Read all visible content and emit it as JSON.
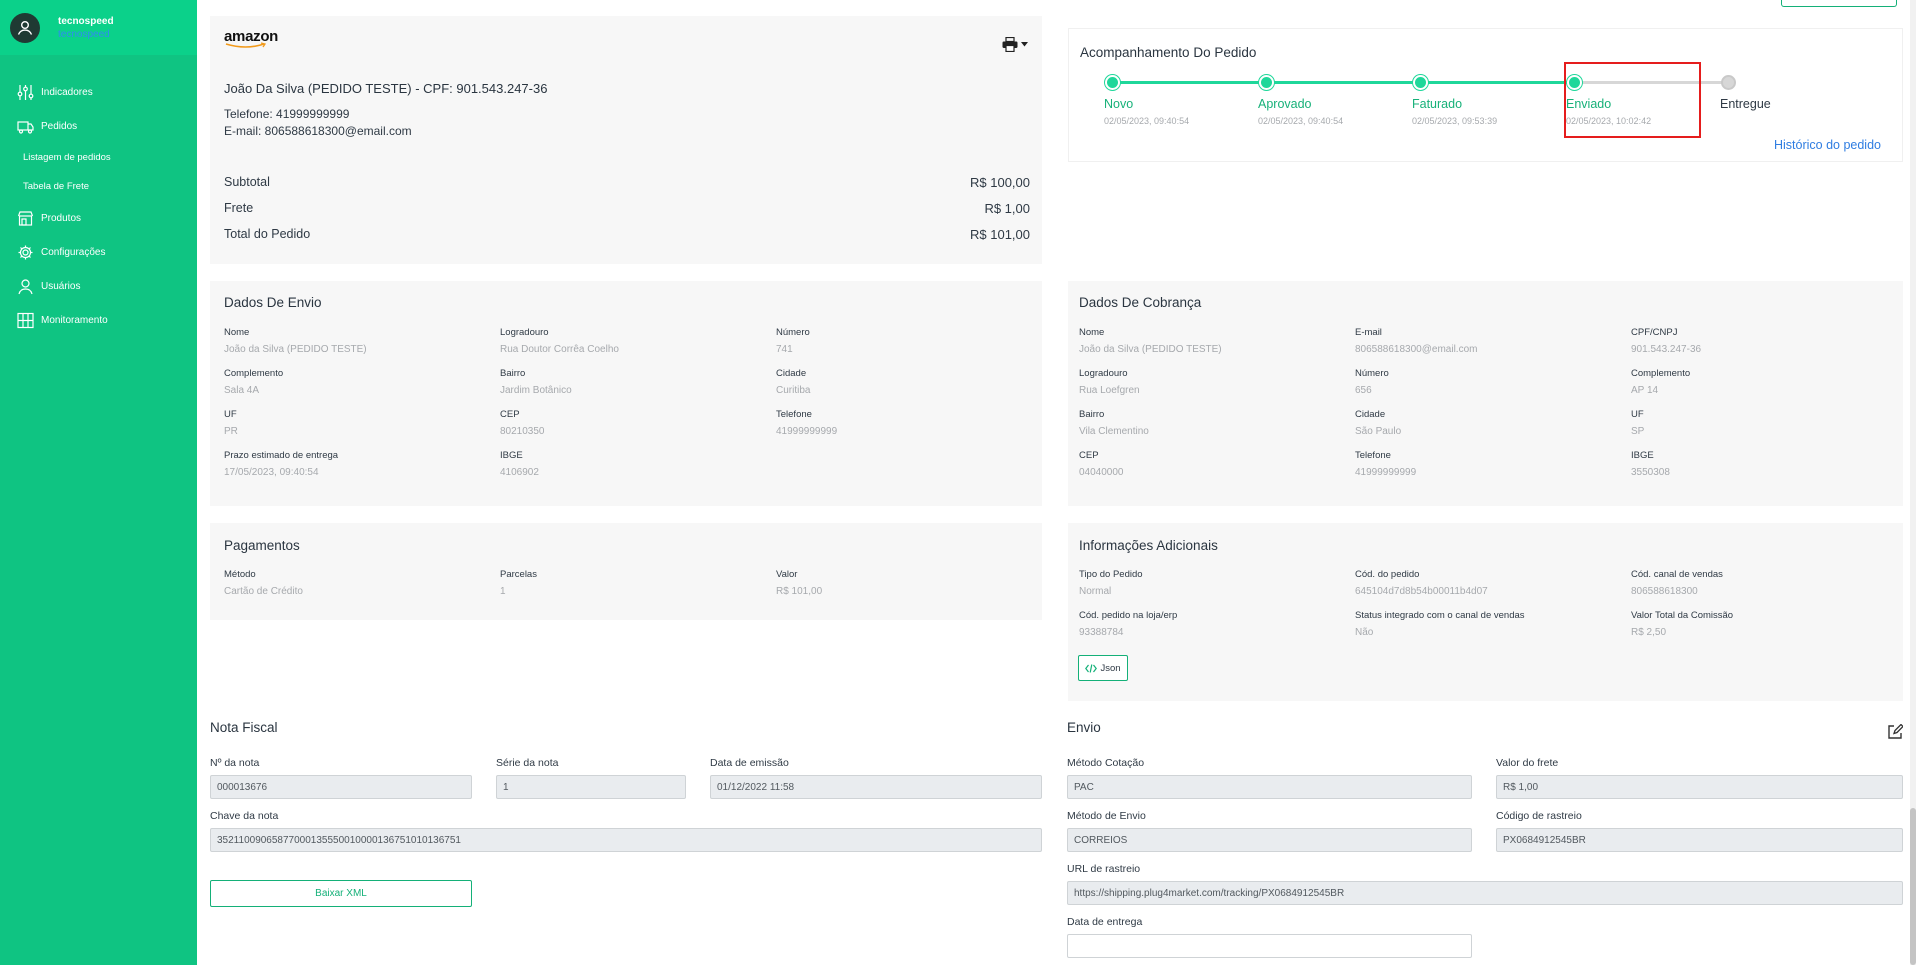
{
  "sidebar": {
    "user": {
      "name": "tecnospeed",
      "subname": "tecnospeed"
    },
    "items": [
      {
        "label": "Indicadores",
        "icon": "sliders-icon"
      },
      {
        "label": "Pedidos",
        "icon": "truck-icon"
      },
      {
        "label": "Listagem de pedidos"
      },
      {
        "label": "Tabela de Frete"
      },
      {
        "label": "Produtos",
        "icon": "store-icon"
      },
      {
        "label": "Configurações",
        "icon": "gear-icon"
      },
      {
        "label": "Usuários",
        "icon": "user-icon"
      },
      {
        "label": "Monitoramento",
        "icon": "monitor-grid-icon"
      }
    ]
  },
  "order": {
    "store_logo": "amazon",
    "customer_line": "João Da Silva (PEDIDO TESTE) - CPF: 901.543.247-36",
    "phone_line": "Telefone: 41999999999",
    "email_line": "E-mail: 806588618300@email.com",
    "summary": [
      {
        "label": "Subtotal",
        "value": "R$ 100,00"
      },
      {
        "label": "Frete",
        "value": "R$ 1,00"
      },
      {
        "label": "Total do Pedido",
        "value": "R$ 101,00"
      }
    ]
  },
  "tracking": {
    "title": "Acompanhamento Do Pedido",
    "steps": [
      {
        "name": "Novo",
        "date": "02/05/2023, 09:40:54",
        "done": true
      },
      {
        "name": "Aprovado",
        "date": "02/05/2023, 09:40:54",
        "done": true
      },
      {
        "name": "Faturado",
        "date": "02/05/2023, 09:53:39",
        "done": true
      },
      {
        "name": "Enviado",
        "date": "02/05/2023, 10:02:42",
        "done": true
      },
      {
        "name": "Entregue",
        "date": "",
        "done": false
      }
    ],
    "history_link": "Histórico do pedido",
    "colors": {
      "done": "#1fd79a",
      "pending": "#d7d7d7",
      "highlight": "#e51d1d"
    }
  },
  "shipping_data": {
    "title": "Dados De Envio",
    "fields": [
      {
        "label": "Nome",
        "value": "João da Silva (PEDIDO TESTE)"
      },
      {
        "label": "Logradouro",
        "value": "Rua Doutor Corrêa Coelho"
      },
      {
        "label": "Número",
        "value": "741"
      },
      {
        "label": "Complemento",
        "value": "Sala 4A"
      },
      {
        "label": "Bairro",
        "value": "Jardim Botânico"
      },
      {
        "label": "Cidade",
        "value": "Curitiba"
      },
      {
        "label": "UF",
        "value": "PR"
      },
      {
        "label": "CEP",
        "value": "80210350"
      },
      {
        "label": "Telefone",
        "value": "41999999999"
      },
      {
        "label": "Prazo estimado de entrega",
        "value": "17/05/2023, 09:40:54"
      },
      {
        "label": "IBGE",
        "value": "4106902"
      }
    ]
  },
  "billing_data": {
    "title": "Dados De Cobrança",
    "fields": [
      {
        "label": "Nome",
        "value": "João da Silva (PEDIDO TESTE)"
      },
      {
        "label": "E-mail",
        "value": "806588618300@email.com"
      },
      {
        "label": "CPF/CNPJ",
        "value": "901.543.247-36"
      },
      {
        "label": "Logradouro",
        "value": "Rua Loefgren"
      },
      {
        "label": "Número",
        "value": "656"
      },
      {
        "label": "Complemento",
        "value": "AP 14"
      },
      {
        "label": "Bairro",
        "value": "Vila Clementino"
      },
      {
        "label": "Cidade",
        "value": "São Paulo"
      },
      {
        "label": "UF",
        "value": "SP"
      },
      {
        "label": "CEP",
        "value": "04040000"
      },
      {
        "label": "Telefone",
        "value": "41999999999"
      },
      {
        "label": "IBGE",
        "value": "3550308"
      }
    ]
  },
  "payments": {
    "title": "Pagamentos",
    "fields": [
      {
        "label": "Método",
        "value": "Cartão de Crédito"
      },
      {
        "label": "Parcelas",
        "value": "1"
      },
      {
        "label": "Valor",
        "value": "R$ 101,00"
      }
    ]
  },
  "additional": {
    "title": "Informações Adicionais",
    "fields": [
      {
        "label": "Tipo do Pedido",
        "value": "Normal"
      },
      {
        "label": "Cód. do pedido",
        "value": "645104d7d8b54b00011b4d07"
      },
      {
        "label": "Cód. canal de vendas",
        "value": "806588618300"
      },
      {
        "label": "Cód. pedido na loja/erp",
        "value": "93388784"
      },
      {
        "label": "Status integrado com o canal de vendas",
        "value": "Não"
      },
      {
        "label": "Valor Total da Comissão",
        "value": "R$ 2,50"
      }
    ],
    "json_button": "Json"
  },
  "invoice": {
    "title": "Nota Fiscal",
    "number_label": "Nº da nota",
    "number_value": "000013676",
    "series_label": "Série da nota",
    "series_value": "1",
    "date_label": "Data de emissão",
    "date_value": "01/12/2022 11:58",
    "key_label": "Chave da nota",
    "key_value": "35211009065877000135550010000136751010136751",
    "download_button": "Baixar XML"
  },
  "shipment": {
    "title": "Envio",
    "quote_label": "Método Cotação",
    "quote_value": "PAC",
    "freight_label": "Valor do frete",
    "freight_value": "R$ 1,00",
    "method_label": "Método de Envio",
    "method_value": "CORREIOS",
    "tracking_label": "Código de rastreio",
    "tracking_value": "PX0684912545BR",
    "url_label": "URL de rastreio",
    "url_value": "https://shipping.plug4market.com/tracking/PX0684912545BR",
    "delivery_label": "Data de entrega",
    "delivery_value": ""
  }
}
